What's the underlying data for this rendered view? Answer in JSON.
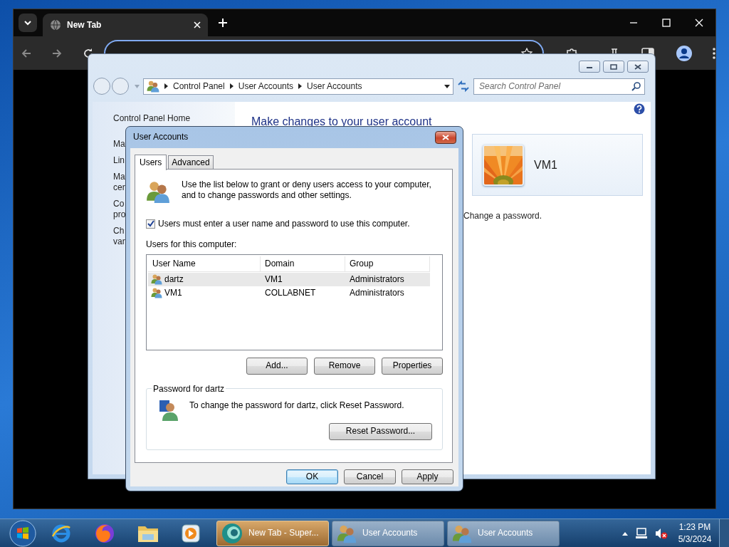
{
  "browser": {
    "tabs": [
      {
        "title": "New Tab",
        "selected": true
      }
    ]
  },
  "control_panel": {
    "breadcrumb": [
      "Control Panel",
      "User Accounts",
      "User Accounts"
    ],
    "search": {
      "placeholder": "Search Control Panel"
    },
    "sidebar": {
      "home": "Control Panel Home",
      "links": [
        {
          "lines": [
            "Ma"
          ]
        },
        {
          "lines": [
            "Lin"
          ]
        },
        {
          "lines": [
            "Ma",
            "cer"
          ]
        },
        {
          "lines": [
            "Co",
            "pro"
          ]
        },
        {
          "lines": [
            "Ch",
            "var"
          ]
        }
      ]
    },
    "heading": "Make changes to your user account",
    "account": {
      "name": "VM1"
    },
    "tasks": [
      "Change a password."
    ]
  },
  "dialog": {
    "title": "User Accounts",
    "tabs": [
      {
        "label": "Users",
        "selected": true
      },
      {
        "label": "Advanced",
        "selected": false
      }
    ],
    "intro": "Use the list below to grant or deny users access to your computer, and to change passwords and other settings.",
    "require_login": {
      "label": "Users must enter a user name and password to use this computer.",
      "checked": true
    },
    "users_label": "Users for this computer:",
    "columns": [
      "User Name",
      "Domain",
      "Group"
    ],
    "rows": [
      {
        "cells": [
          "dartz",
          "VM1",
          "Administrators"
        ],
        "selected": true
      },
      {
        "cells": [
          "VM1",
          "COLLABNET",
          "Administrators"
        ],
        "selected": false
      }
    ],
    "list_buttons": [
      "Add...",
      "Remove",
      "Properties"
    ],
    "password_group": {
      "title": "Password for dartz",
      "text": "To change the password for dartz, click Reset Password.",
      "button": "Reset Password..."
    },
    "buttons": [
      {
        "label": "OK",
        "default": true
      },
      {
        "label": "Cancel",
        "default": false
      },
      {
        "label": "Apply",
        "default": false
      }
    ]
  },
  "taskbar": {
    "tasks": [
      {
        "label": "New Tab - Super...",
        "kind": "browser",
        "active": true
      },
      {
        "label": "User Accounts",
        "kind": "users",
        "active": false
      },
      {
        "label": "User Accounts",
        "kind": "users",
        "active": false
      }
    ],
    "clock": {
      "time": "1:23 PM",
      "date": "5/3/2024"
    }
  }
}
